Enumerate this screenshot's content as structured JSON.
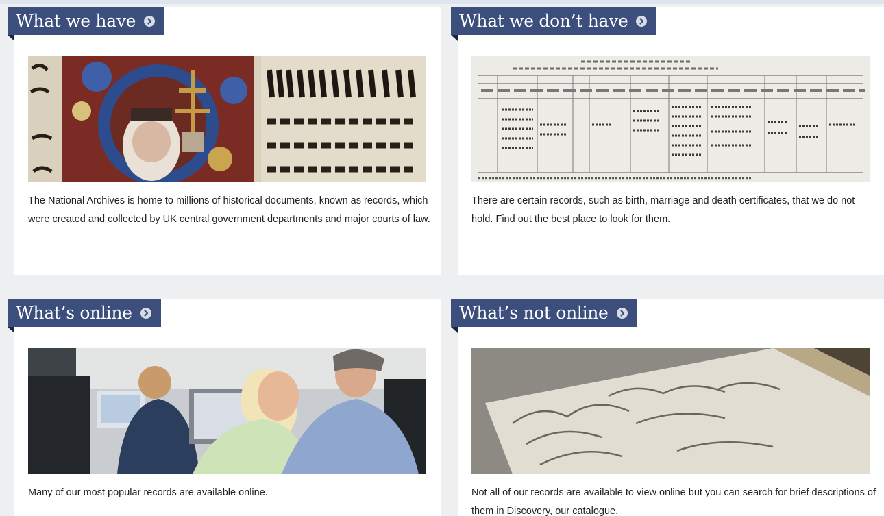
{
  "cards": [
    {
      "title": "What we have",
      "description": "The National Archives is home to millions of historical documents, known as records, which were created and collected by UK central government departments and major courts of law."
    },
    {
      "title": "What we don’t have",
      "description": "There are certain records, such as birth, marriage and death certificates, that we do not hold. Find out the best place to look for them."
    },
    {
      "title": "What’s online",
      "description": "Many of our most popular records are available online."
    },
    {
      "title": "What’s not online",
      "description": "Not all of our records are available to view online but you can search for brief descriptions of them in Discovery, our catalogue."
    }
  ],
  "colors": {
    "header_bg": "#3b4e7c",
    "page_bg": "#eeeff1",
    "card_bg": "#ffffff"
  },
  "icons": {
    "header_arrow": "chevron-right-circle-icon"
  }
}
